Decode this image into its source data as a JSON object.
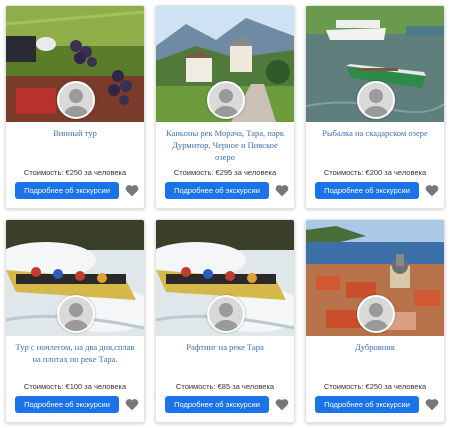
{
  "theme": {
    "accent": "#1a73e8",
    "title_color": "#3b72b5",
    "heart_color": "#777777"
  },
  "tours": [
    {
      "title": "Винный тур",
      "price": "Стоимость: €250 за человека",
      "button": "Подробнее об экскурсии",
      "image": "vineyard-harvest-photo",
      "icon": "heart-icon"
    },
    {
      "title": "Каньоны рек Морача, Тара, парк Дурмитор, Черное и Пивское озеро",
      "price": "Стоимость: €295 за человека",
      "button": "Подробнее об экскурсии",
      "image": "monastery-mountains-photo",
      "icon": "heart-icon"
    },
    {
      "title": "Рыбалка на скадарском озере",
      "price": "Стоимость: €200 за человека",
      "button": "Подробнее об экскурсии",
      "image": "lake-boats-photo",
      "icon": "heart-icon"
    },
    {
      "title": "Тур с ночлегом, на два дня,сплав на плотах по реке Тара.",
      "price": "Стоимость: €100 за человека",
      "button": "Подробнее об экскурсии",
      "image": "river-rafting-photo",
      "icon": "heart-icon"
    },
    {
      "title": "Рафтинг на реке Тара",
      "price": "Стоимость: €85 за человека",
      "button": "Подробнее об экскурсии",
      "image": "river-rafting-photo",
      "icon": "heart-icon"
    },
    {
      "title": "Дубровник",
      "price": "Стоимость: €250 за человека",
      "button": "Подробнее об экскурсии",
      "image": "dubrovnik-city-photo",
      "icon": "heart-icon"
    }
  ]
}
